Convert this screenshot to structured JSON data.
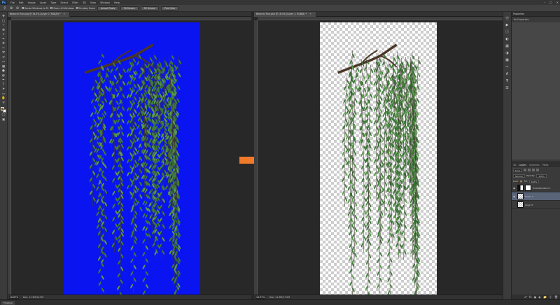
{
  "app": {
    "logo": "Ps",
    "menu": [
      "File",
      "Edit",
      "Image",
      "Layer",
      "Type",
      "Select",
      "Filter",
      "3D",
      "View",
      "Window",
      "Help"
    ],
    "window_controls": [
      "–",
      "□",
      "✕"
    ]
  },
  "options_bar": {
    "checks": [
      "Resize Windows to Fit",
      "Zoom All Windows",
      "Scrubby Zoom"
    ],
    "buttons": [
      "Actual Pixels",
      "Fit Screen",
      "Fill Screen",
      "Print Size"
    ]
  },
  "documents": [
    {
      "tab_title": "Beanchi Fish.png @ 16.5% (Layer 0, RGB/8) *",
      "zoom": "16.67%",
      "doc_info": "Doc: 11.9M/12.9M",
      "canvas_color": "#0a14f0"
    },
    {
      "tab_title": "Beanchi Fish.psd @ 16.5% (Layer 1, RGB/8) *",
      "zoom": "16.67%",
      "doc_info": "Doc: 11.9M/17.0M"
    }
  ],
  "arrow": {
    "color": "#f07a2a"
  },
  "properties": {
    "header": "Properties",
    "subtitle": "No Properties"
  },
  "layers_panel": {
    "tabs": [
      "3D",
      "Layers",
      "Channels",
      "Paths"
    ],
    "active_tab": "Layers",
    "kind_label": "Kind",
    "blend_mode": "Normal",
    "opacity_label": "Opacity:",
    "opacity_value": "100%",
    "lock_label": "Lock:",
    "fill_label": "Fill:",
    "fill_value": "100%",
    "layers": [
      {
        "name": "Hue/Saturation 1",
        "type": "adjustment",
        "selected": false
      },
      {
        "name": "Layer 1",
        "type": "pixel",
        "selected": true
      },
      {
        "name": "Layer 0",
        "type": "pixel",
        "selected": false
      }
    ]
  },
  "bottom_tab": "Timeline"
}
